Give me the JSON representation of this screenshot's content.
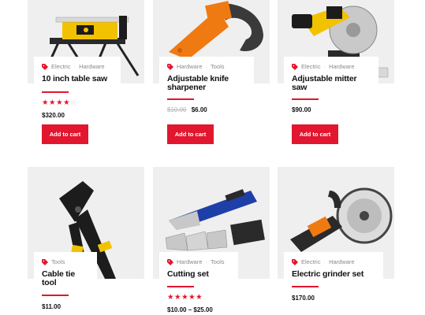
{
  "colors": {
    "accent": "#e2162e",
    "image_bg": "#efefef",
    "muted": "#8a8a8a"
  },
  "products": [
    {
      "categories": [
        "Electric",
        "Hardware"
      ],
      "title": "10 inch table saw",
      "rating": 4,
      "rating_max": 5,
      "price": "$320.00",
      "button": "Add to cart",
      "image_icon": "table-saw-image"
    },
    {
      "categories": [
        "Hardware",
        "Tools"
      ],
      "title": "Adjustable knife sharpener",
      "old_price": "$10.00",
      "price": "$6.00",
      "button": "Add to cart",
      "image_icon": "knife-sharpener-image"
    },
    {
      "categories": [
        "Electric",
        "Hardware"
      ],
      "title": "Adjustable mitter saw",
      "price": "$90.00",
      "button": "Add to cart",
      "image_icon": "miter-saw-image"
    },
    {
      "categories": [
        "Tools"
      ],
      "title": "Cable tie tool",
      "price": "$11.00",
      "image_icon": "cable-tie-tool-image"
    },
    {
      "categories": [
        "Hardware",
        "Tools"
      ],
      "title": "Cutting set",
      "rating": 5,
      "rating_max": 5,
      "price": "$10.00 – $25.00",
      "image_icon": "cutting-set-image"
    },
    {
      "categories": [
        "Electric",
        "Hardware"
      ],
      "title": "Electric grinder set",
      "price": "$170.00",
      "image_icon": "grinder-image"
    }
  ]
}
